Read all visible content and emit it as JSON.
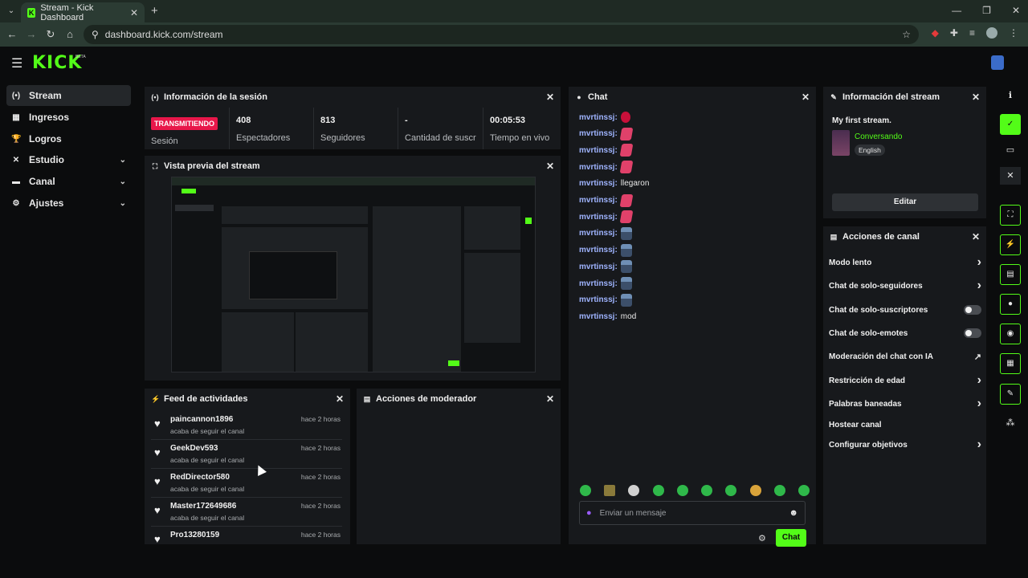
{
  "browser": {
    "tab_title": "Stream - Kick Dashboard",
    "favicon": "K",
    "url": "dashboard.kick.com/stream",
    "icons": [
      "back-icon",
      "forward-icon",
      "reload-icon",
      "home-icon",
      "site-info-icon",
      "star-icon",
      "extension-icon",
      "menu-icon"
    ]
  },
  "header": {
    "logo": "KICK",
    "beta": "BETA"
  },
  "sidebar": {
    "items": [
      {
        "label": "Stream",
        "icon": "(•)"
      },
      {
        "label": "Ingresos",
        "icon": "▦"
      },
      {
        "label": "Logros",
        "icon": "🏆"
      },
      {
        "label": "Estudio",
        "icon": "✕"
      },
      {
        "label": "Canal",
        "icon": "▬"
      },
      {
        "label": "Ajustes",
        "icon": "⚙"
      }
    ]
  },
  "session": {
    "title": "Información de la sesión",
    "badge": "TRANSMITIENDO",
    "badge_label": "Sesión",
    "stats": [
      {
        "value": "408",
        "label": "Espectadores"
      },
      {
        "value": "813",
        "label": "Seguidores"
      },
      {
        "value": "-",
        "label": "Cantidad de suscripciones"
      },
      {
        "value": "00:05:53",
        "label": "Tiempo en vivo"
      }
    ]
  },
  "preview": {
    "title": "Vista previa del stream"
  },
  "feed": {
    "title": "Feed de actividades",
    "items": [
      {
        "name": "paincannon1896",
        "sub": "acaba de seguir el canal",
        "time": "hace 2 horas"
      },
      {
        "name": "GeekDev593",
        "sub": "acaba de seguir el canal",
        "time": "hace 2 horas"
      },
      {
        "name": "RedDirector580",
        "sub": "acaba de seguir el canal",
        "time": "hace 2 horas"
      },
      {
        "name": "Master172649686",
        "sub": "acaba de seguir el canal",
        "time": "hace 2 horas"
      },
      {
        "name": "Pro13280159",
        "sub": "",
        "time": "hace 2 horas"
      }
    ]
  },
  "mod_actions": {
    "title": "Acciones de moderador"
  },
  "chat": {
    "title": "Chat",
    "messages": [
      {
        "user": "mvrtinssj:",
        "text": "",
        "emote": "red"
      },
      {
        "user": "mvrtinssj:",
        "text": "",
        "emote": "pink"
      },
      {
        "user": "mvrtinssj:",
        "text": "",
        "emote": "pink"
      },
      {
        "user": "mvrtinssj:",
        "text": "",
        "emote": "pink"
      },
      {
        "user": "mvrtinssj:",
        "text": "llegaron",
        "emote": ""
      },
      {
        "user": "mvrtinssj:",
        "text": "",
        "emote": "pink"
      },
      {
        "user": "mvrtinssj:",
        "text": "",
        "emote": "pink"
      },
      {
        "user": "mvrtinssj:",
        "text": "",
        "emote": "pc"
      },
      {
        "user": "mvrtinssj:",
        "text": "",
        "emote": "pc"
      },
      {
        "user": "mvrtinssj:",
        "text": "",
        "emote": "pc"
      },
      {
        "user": "mvrtinssj:",
        "text": "",
        "emote": "pc"
      },
      {
        "user": "mvrtinssj:",
        "text": "",
        "emote": "pc"
      },
      {
        "user": "mvrtinssj:",
        "text": "mod",
        "emote": ""
      }
    ],
    "placeholder": "Enviar un mensaje",
    "send_label": "Chat",
    "accent": "#53fc18"
  },
  "stream_info": {
    "title": "Información del stream",
    "stream_title": "My first stream.",
    "category": "Conversando",
    "language": "English",
    "edit_label": "Editar"
  },
  "channel_actions": {
    "title": "Acciones de canal",
    "items": [
      {
        "label": "Modo lento",
        "control": "chevron"
      },
      {
        "label": "Chat de solo-seguidores",
        "control": "chevron"
      },
      {
        "label": "Chat de solo-suscriptores",
        "control": "toggle"
      },
      {
        "label": "Chat de solo-emotes",
        "control": "toggle"
      },
      {
        "label": "Moderación del chat con IA",
        "control": "external"
      },
      {
        "label": "Restricción de edad",
        "control": "chevron"
      },
      {
        "label": "Palabras baneadas",
        "control": "chevron"
      },
      {
        "label": "Hostear canal",
        "control": "none"
      },
      {
        "label": "Configurar objetivos",
        "control": "chevron"
      }
    ]
  }
}
